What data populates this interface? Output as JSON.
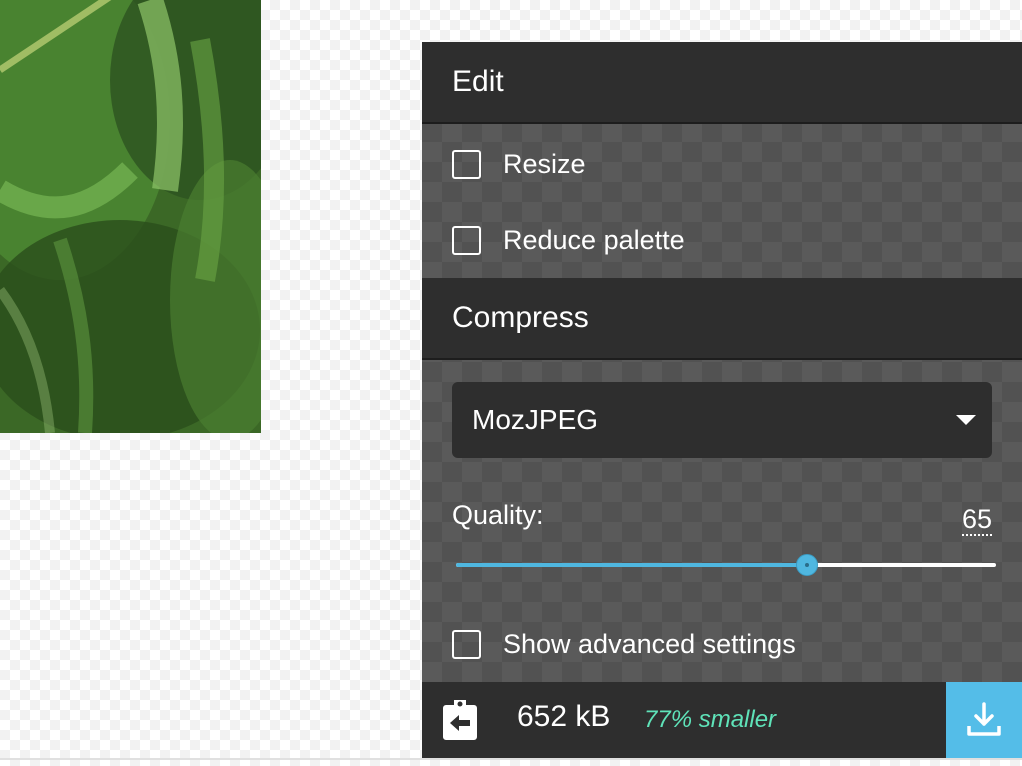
{
  "image_preview": {
    "colors": {
      "dark": "#2f5a22",
      "mid": "#4f8a35",
      "light": "#7fb35a"
    }
  },
  "options_panel": {
    "edit_section": {
      "title": "Edit",
      "resize_label": "Resize",
      "resize_checked": false,
      "reduce_palette_label": "Reduce palette",
      "reduce_palette_checked": false
    },
    "compress_section": {
      "title": "Compress",
      "codec": {
        "selected": "MozJPEG",
        "icon": "chevron-down-icon"
      },
      "quality": {
        "label": "Quality:",
        "value": "65",
        "min": 0,
        "max": 100,
        "level": 65
      },
      "advanced_label": "Show advanced settings",
      "advanced_checked": false
    },
    "footer": {
      "back_icon": "copy-back-icon",
      "size": "652 kB",
      "diff": "77% smaller",
      "download_icon": "download-icon"
    },
    "colors": {
      "header_bg": "#2e2e2e",
      "accent_blue": "#54bde8",
      "diff_green": "#5fe3b9"
    }
  }
}
